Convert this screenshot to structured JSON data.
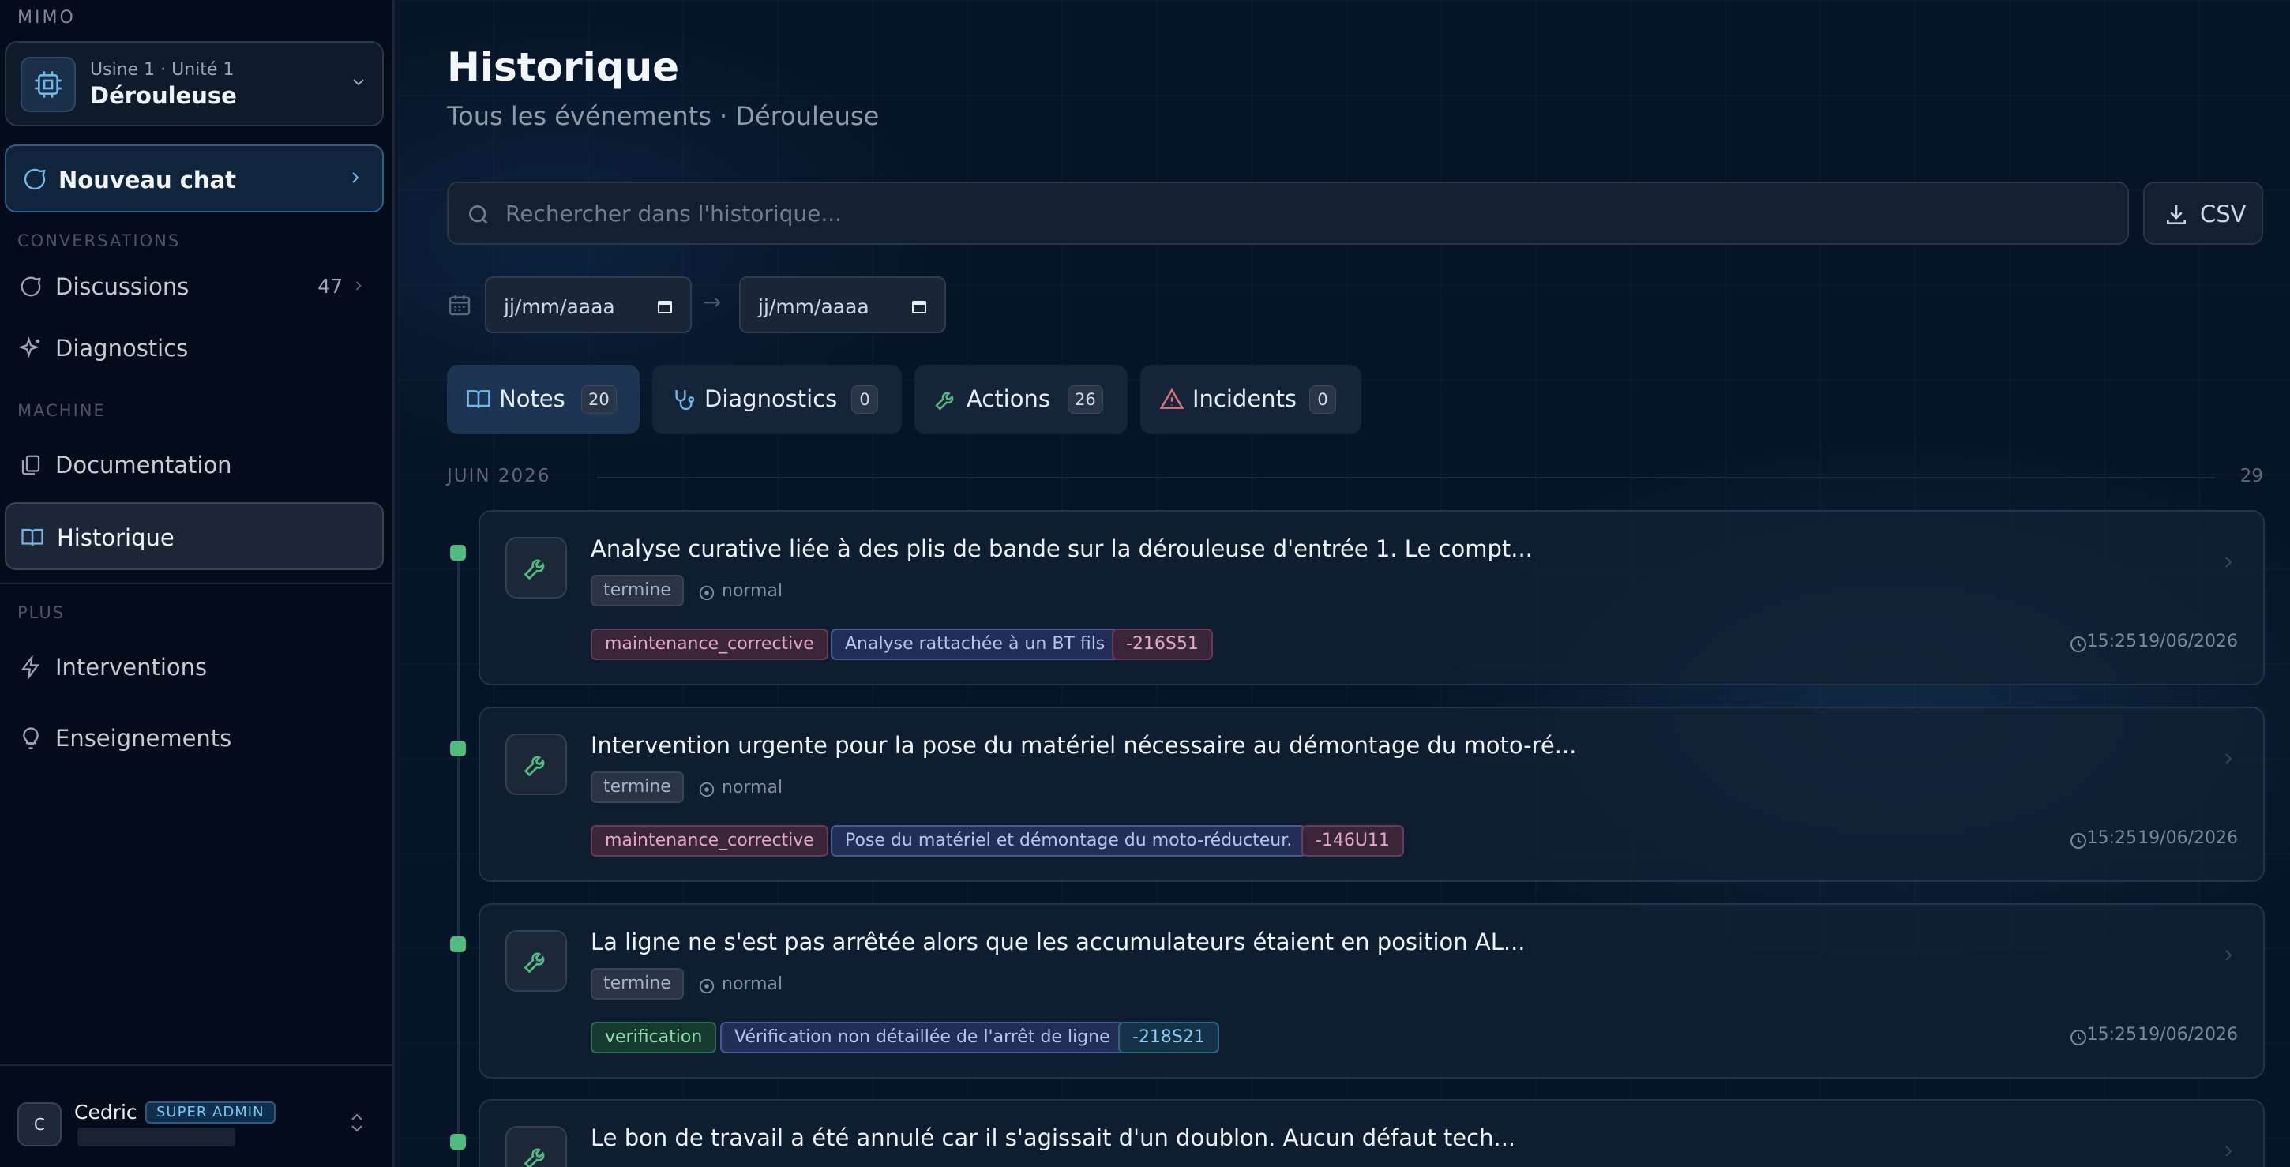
{
  "sidebar": {
    "brand": "MIMO",
    "machine": {
      "sub": "Usine 1 · Unité 1",
      "name": "Dérouleuse"
    },
    "new_chat": "Nouveau chat",
    "sections": {
      "conversations": "CONVERSATIONS",
      "machine": "MACHINE",
      "plus": "PLUS"
    },
    "items": [
      {
        "label": "Discussions",
        "count": "47"
      },
      {
        "label": "Diagnostics"
      },
      {
        "label": "Documentation"
      },
      {
        "label": "Historique"
      },
      {
        "label": "Interventions"
      },
      {
        "label": "Enseignements"
      }
    ],
    "user": {
      "initial": "C",
      "name": "Cedric",
      "badge": "SUPER ADMIN"
    }
  },
  "main": {
    "title": "Historique",
    "subtitle": "Tous les événements · Dérouleuse",
    "search_placeholder": "Rechercher dans l'historique...",
    "csv_label": "CSV",
    "date_from": "jj/mm/aaaa",
    "date_to": "jj/mm/aaaa",
    "date_arrow": "→",
    "tabs": [
      {
        "label": "Notes",
        "count": "20"
      },
      {
        "label": "Diagnostics",
        "count": "0"
      },
      {
        "label": "Actions",
        "count": "26"
      },
      {
        "label": "Incidents",
        "count": "0"
      }
    ],
    "month": {
      "label": "JUIN 2026",
      "count": "29"
    },
    "events": [
      {
        "title": "Analyse curative liée à des plis de bande sur la dérouleuse d'entrée 1. Le compt...",
        "status": "termine",
        "priority": "normal",
        "tags": [
          "maintenance_corrective",
          "Analyse rattachée à un BT fils",
          "-216S51"
        ],
        "time": "15:25",
        "date": "19/06/2026"
      },
      {
        "title": "Intervention urgente pour la pose du matériel nécessaire au démontage du moto-ré...",
        "status": "termine",
        "priority": "normal",
        "tags": [
          "maintenance_corrective",
          "Pose du matériel et démontage du moto-réducteur.",
          "-146U11"
        ],
        "time": "15:25",
        "date": "19/06/2026"
      },
      {
        "title": "La ligne ne s'est pas arrêtée alors que les accumulateurs étaient en position AL...",
        "status": "termine",
        "priority": "normal",
        "tags": [
          "verification",
          "Vérification non détaillée de l'arrêt de ligne",
          "-218S21"
        ],
        "time": "15:25",
        "date": "19/06/2026"
      },
      {
        "title": "Le bon de travail a été annulé car il s'agissait d'un doublon. Aucun défaut tech..."
      }
    ]
  },
  "colors": {
    "accent": "#4fbd7d",
    "brand_blue": "#2a5f88",
    "warning": "#e0737a"
  }
}
